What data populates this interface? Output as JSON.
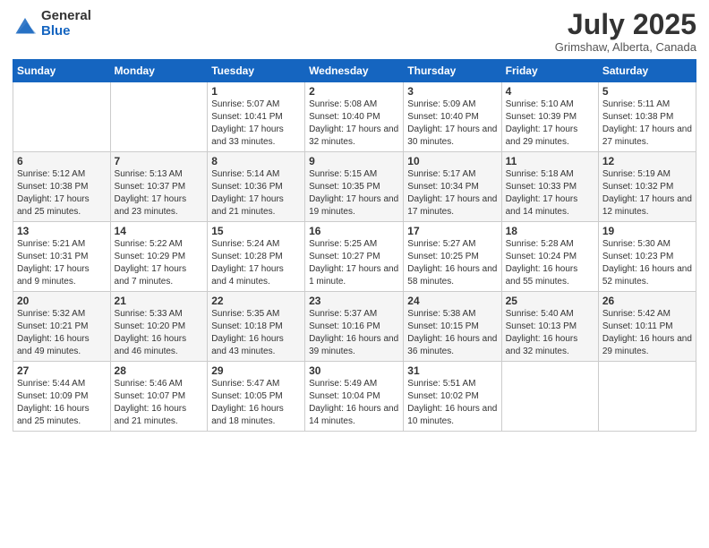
{
  "header": {
    "logo_general": "General",
    "logo_blue": "Blue",
    "month_title": "July 2025",
    "location": "Grimshaw, Alberta, Canada"
  },
  "weekdays": [
    "Sunday",
    "Monday",
    "Tuesday",
    "Wednesday",
    "Thursday",
    "Friday",
    "Saturday"
  ],
  "weeks": [
    [
      {
        "day": "",
        "sunrise": "",
        "sunset": "",
        "daylight": ""
      },
      {
        "day": "",
        "sunrise": "",
        "sunset": "",
        "daylight": ""
      },
      {
        "day": "1",
        "sunrise": "Sunrise: 5:07 AM",
        "sunset": "Sunset: 10:41 PM",
        "daylight": "Daylight: 17 hours and 33 minutes."
      },
      {
        "day": "2",
        "sunrise": "Sunrise: 5:08 AM",
        "sunset": "Sunset: 10:40 PM",
        "daylight": "Daylight: 17 hours and 32 minutes."
      },
      {
        "day": "3",
        "sunrise": "Sunrise: 5:09 AM",
        "sunset": "Sunset: 10:40 PM",
        "daylight": "Daylight: 17 hours and 30 minutes."
      },
      {
        "day": "4",
        "sunrise": "Sunrise: 5:10 AM",
        "sunset": "Sunset: 10:39 PM",
        "daylight": "Daylight: 17 hours and 29 minutes."
      },
      {
        "day": "5",
        "sunrise": "Sunrise: 5:11 AM",
        "sunset": "Sunset: 10:38 PM",
        "daylight": "Daylight: 17 hours and 27 minutes."
      }
    ],
    [
      {
        "day": "6",
        "sunrise": "Sunrise: 5:12 AM",
        "sunset": "Sunset: 10:38 PM",
        "daylight": "Daylight: 17 hours and 25 minutes."
      },
      {
        "day": "7",
        "sunrise": "Sunrise: 5:13 AM",
        "sunset": "Sunset: 10:37 PM",
        "daylight": "Daylight: 17 hours and 23 minutes."
      },
      {
        "day": "8",
        "sunrise": "Sunrise: 5:14 AM",
        "sunset": "Sunset: 10:36 PM",
        "daylight": "Daylight: 17 hours and 21 minutes."
      },
      {
        "day": "9",
        "sunrise": "Sunrise: 5:15 AM",
        "sunset": "Sunset: 10:35 PM",
        "daylight": "Daylight: 17 hours and 19 minutes."
      },
      {
        "day": "10",
        "sunrise": "Sunrise: 5:17 AM",
        "sunset": "Sunset: 10:34 PM",
        "daylight": "Daylight: 17 hours and 17 minutes."
      },
      {
        "day": "11",
        "sunrise": "Sunrise: 5:18 AM",
        "sunset": "Sunset: 10:33 PM",
        "daylight": "Daylight: 17 hours and 14 minutes."
      },
      {
        "day": "12",
        "sunrise": "Sunrise: 5:19 AM",
        "sunset": "Sunset: 10:32 PM",
        "daylight": "Daylight: 17 hours and 12 minutes."
      }
    ],
    [
      {
        "day": "13",
        "sunrise": "Sunrise: 5:21 AM",
        "sunset": "Sunset: 10:31 PM",
        "daylight": "Daylight: 17 hours and 9 minutes."
      },
      {
        "day": "14",
        "sunrise": "Sunrise: 5:22 AM",
        "sunset": "Sunset: 10:29 PM",
        "daylight": "Daylight: 17 hours and 7 minutes."
      },
      {
        "day": "15",
        "sunrise": "Sunrise: 5:24 AM",
        "sunset": "Sunset: 10:28 PM",
        "daylight": "Daylight: 17 hours and 4 minutes."
      },
      {
        "day": "16",
        "sunrise": "Sunrise: 5:25 AM",
        "sunset": "Sunset: 10:27 PM",
        "daylight": "Daylight: 17 hours and 1 minute."
      },
      {
        "day": "17",
        "sunrise": "Sunrise: 5:27 AM",
        "sunset": "Sunset: 10:25 PM",
        "daylight": "Daylight: 16 hours and 58 minutes."
      },
      {
        "day": "18",
        "sunrise": "Sunrise: 5:28 AM",
        "sunset": "Sunset: 10:24 PM",
        "daylight": "Daylight: 16 hours and 55 minutes."
      },
      {
        "day": "19",
        "sunrise": "Sunrise: 5:30 AM",
        "sunset": "Sunset: 10:23 PM",
        "daylight": "Daylight: 16 hours and 52 minutes."
      }
    ],
    [
      {
        "day": "20",
        "sunrise": "Sunrise: 5:32 AM",
        "sunset": "Sunset: 10:21 PM",
        "daylight": "Daylight: 16 hours and 49 minutes."
      },
      {
        "day": "21",
        "sunrise": "Sunrise: 5:33 AM",
        "sunset": "Sunset: 10:20 PM",
        "daylight": "Daylight: 16 hours and 46 minutes."
      },
      {
        "day": "22",
        "sunrise": "Sunrise: 5:35 AM",
        "sunset": "Sunset: 10:18 PM",
        "daylight": "Daylight: 16 hours and 43 minutes."
      },
      {
        "day": "23",
        "sunrise": "Sunrise: 5:37 AM",
        "sunset": "Sunset: 10:16 PM",
        "daylight": "Daylight: 16 hours and 39 minutes."
      },
      {
        "day": "24",
        "sunrise": "Sunrise: 5:38 AM",
        "sunset": "Sunset: 10:15 PM",
        "daylight": "Daylight: 16 hours and 36 minutes."
      },
      {
        "day": "25",
        "sunrise": "Sunrise: 5:40 AM",
        "sunset": "Sunset: 10:13 PM",
        "daylight": "Daylight: 16 hours and 32 minutes."
      },
      {
        "day": "26",
        "sunrise": "Sunrise: 5:42 AM",
        "sunset": "Sunset: 10:11 PM",
        "daylight": "Daylight: 16 hours and 29 minutes."
      }
    ],
    [
      {
        "day": "27",
        "sunrise": "Sunrise: 5:44 AM",
        "sunset": "Sunset: 10:09 PM",
        "daylight": "Daylight: 16 hours and 25 minutes."
      },
      {
        "day": "28",
        "sunrise": "Sunrise: 5:46 AM",
        "sunset": "Sunset: 10:07 PM",
        "daylight": "Daylight: 16 hours and 21 minutes."
      },
      {
        "day": "29",
        "sunrise": "Sunrise: 5:47 AM",
        "sunset": "Sunset: 10:05 PM",
        "daylight": "Daylight: 16 hours and 18 minutes."
      },
      {
        "day": "30",
        "sunrise": "Sunrise: 5:49 AM",
        "sunset": "Sunset: 10:04 PM",
        "daylight": "Daylight: 16 hours and 14 minutes."
      },
      {
        "day": "31",
        "sunrise": "Sunrise: 5:51 AM",
        "sunset": "Sunset: 10:02 PM",
        "daylight": "Daylight: 16 hours and 10 minutes."
      },
      {
        "day": "",
        "sunrise": "",
        "sunset": "",
        "daylight": ""
      },
      {
        "day": "",
        "sunrise": "",
        "sunset": "",
        "daylight": ""
      }
    ]
  ]
}
